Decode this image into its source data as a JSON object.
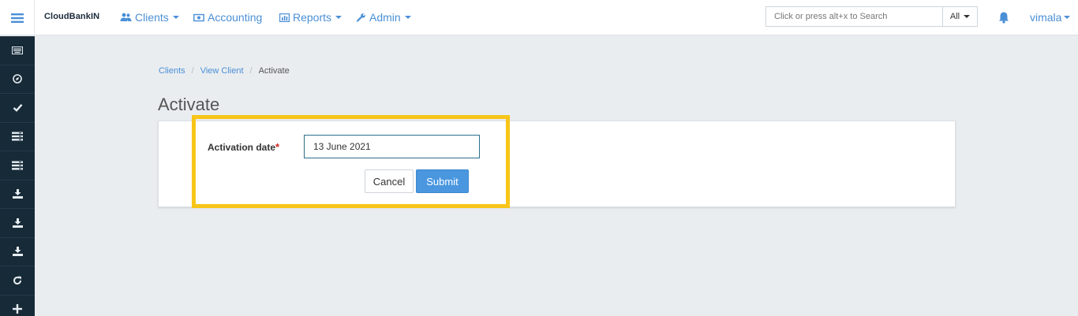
{
  "navbar": {
    "brand": "CloudBankIN",
    "menu": [
      {
        "label": "Clients",
        "icon": "users-icon",
        "dropdown": true
      },
      {
        "label": "Accounting",
        "icon": "money-icon",
        "dropdown": false
      },
      {
        "label": "Reports",
        "icon": "bar-chart-icon",
        "dropdown": true
      },
      {
        "label": "Admin",
        "icon": "wrench-icon",
        "dropdown": true
      }
    ],
    "search": {
      "placeholder": "Click or press alt+x to Search",
      "scope": "All"
    },
    "user": "vimala"
  },
  "sidebar": {
    "icons": [
      "keyboard-icon",
      "compass-icon",
      "check-icon",
      "list-icon",
      "list-icon",
      "download-icon",
      "download-icon",
      "download-icon",
      "refresh-icon",
      "plus-icon"
    ]
  },
  "breadcrumb": {
    "items": [
      "Clients",
      "View Client"
    ],
    "current": "Activate"
  },
  "page": {
    "title": "Activate"
  },
  "form": {
    "activation_label": "Activation date",
    "required_mark": "*",
    "activation_value": "13 June 2021",
    "cancel_label": "Cancel",
    "submit_label": "Submit"
  },
  "colors": {
    "accent": "#4a8fd6",
    "sidebar": "#172a38",
    "highlight": "#f7c518",
    "submit": "#4a97e0"
  }
}
